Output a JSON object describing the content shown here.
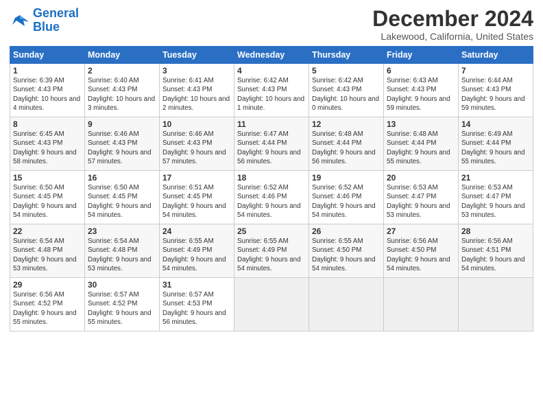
{
  "header": {
    "logo_line1": "General",
    "logo_line2": "Blue",
    "month": "December 2024",
    "location": "Lakewood, California, United States"
  },
  "days_of_week": [
    "Sunday",
    "Monday",
    "Tuesday",
    "Wednesday",
    "Thursday",
    "Friday",
    "Saturday"
  ],
  "weeks": [
    [
      {
        "day": "1",
        "sunrise": "6:39 AM",
        "sunset": "4:43 PM",
        "daylight": "10 hours and 4 minutes."
      },
      {
        "day": "2",
        "sunrise": "6:40 AM",
        "sunset": "4:43 PM",
        "daylight": "10 hours and 3 minutes."
      },
      {
        "day": "3",
        "sunrise": "6:41 AM",
        "sunset": "4:43 PM",
        "daylight": "10 hours and 2 minutes."
      },
      {
        "day": "4",
        "sunrise": "6:42 AM",
        "sunset": "4:43 PM",
        "daylight": "10 hours and 1 minute."
      },
      {
        "day": "5",
        "sunrise": "6:42 AM",
        "sunset": "4:43 PM",
        "daylight": "10 hours and 0 minutes."
      },
      {
        "day": "6",
        "sunrise": "6:43 AM",
        "sunset": "4:43 PM",
        "daylight": "9 hours and 59 minutes."
      },
      {
        "day": "7",
        "sunrise": "6:44 AM",
        "sunset": "4:43 PM",
        "daylight": "9 hours and 59 minutes."
      }
    ],
    [
      {
        "day": "8",
        "sunrise": "6:45 AM",
        "sunset": "4:43 PM",
        "daylight": "9 hours and 58 minutes."
      },
      {
        "day": "9",
        "sunrise": "6:46 AM",
        "sunset": "4:43 PM",
        "daylight": "9 hours and 57 minutes."
      },
      {
        "day": "10",
        "sunrise": "6:46 AM",
        "sunset": "4:43 PM",
        "daylight": "9 hours and 57 minutes."
      },
      {
        "day": "11",
        "sunrise": "6:47 AM",
        "sunset": "4:44 PM",
        "daylight": "9 hours and 56 minutes."
      },
      {
        "day": "12",
        "sunrise": "6:48 AM",
        "sunset": "4:44 PM",
        "daylight": "9 hours and 56 minutes."
      },
      {
        "day": "13",
        "sunrise": "6:48 AM",
        "sunset": "4:44 PM",
        "daylight": "9 hours and 55 minutes."
      },
      {
        "day": "14",
        "sunrise": "6:49 AM",
        "sunset": "4:44 PM",
        "daylight": "9 hours and 55 minutes."
      }
    ],
    [
      {
        "day": "15",
        "sunrise": "6:50 AM",
        "sunset": "4:45 PM",
        "daylight": "9 hours and 54 minutes."
      },
      {
        "day": "16",
        "sunrise": "6:50 AM",
        "sunset": "4:45 PM",
        "daylight": "9 hours and 54 minutes."
      },
      {
        "day": "17",
        "sunrise": "6:51 AM",
        "sunset": "4:45 PM",
        "daylight": "9 hours and 54 minutes."
      },
      {
        "day": "18",
        "sunrise": "6:52 AM",
        "sunset": "4:46 PM",
        "daylight": "9 hours and 54 minutes."
      },
      {
        "day": "19",
        "sunrise": "6:52 AM",
        "sunset": "4:46 PM",
        "daylight": "9 hours and 54 minutes."
      },
      {
        "day": "20",
        "sunrise": "6:53 AM",
        "sunset": "4:47 PM",
        "daylight": "9 hours and 53 minutes."
      },
      {
        "day": "21",
        "sunrise": "6:53 AM",
        "sunset": "4:47 PM",
        "daylight": "9 hours and 53 minutes."
      }
    ],
    [
      {
        "day": "22",
        "sunrise": "6:54 AM",
        "sunset": "4:48 PM",
        "daylight": "9 hours and 53 minutes."
      },
      {
        "day": "23",
        "sunrise": "6:54 AM",
        "sunset": "4:48 PM",
        "daylight": "9 hours and 53 minutes."
      },
      {
        "day": "24",
        "sunrise": "6:55 AM",
        "sunset": "4:49 PM",
        "daylight": "9 hours and 54 minutes."
      },
      {
        "day": "25",
        "sunrise": "6:55 AM",
        "sunset": "4:49 PM",
        "daylight": "9 hours and 54 minutes."
      },
      {
        "day": "26",
        "sunrise": "6:55 AM",
        "sunset": "4:50 PM",
        "daylight": "9 hours and 54 minutes."
      },
      {
        "day": "27",
        "sunrise": "6:56 AM",
        "sunset": "4:50 PM",
        "daylight": "9 hours and 54 minutes."
      },
      {
        "day": "28",
        "sunrise": "6:56 AM",
        "sunset": "4:51 PM",
        "daylight": "9 hours and 54 minutes."
      }
    ],
    [
      {
        "day": "29",
        "sunrise": "6:56 AM",
        "sunset": "4:52 PM",
        "daylight": "9 hours and 55 minutes."
      },
      {
        "day": "30",
        "sunrise": "6:57 AM",
        "sunset": "4:52 PM",
        "daylight": "9 hours and 55 minutes."
      },
      {
        "day": "31",
        "sunrise": "6:57 AM",
        "sunset": "4:53 PM",
        "daylight": "9 hours and 56 minutes."
      },
      null,
      null,
      null,
      null
    ]
  ]
}
